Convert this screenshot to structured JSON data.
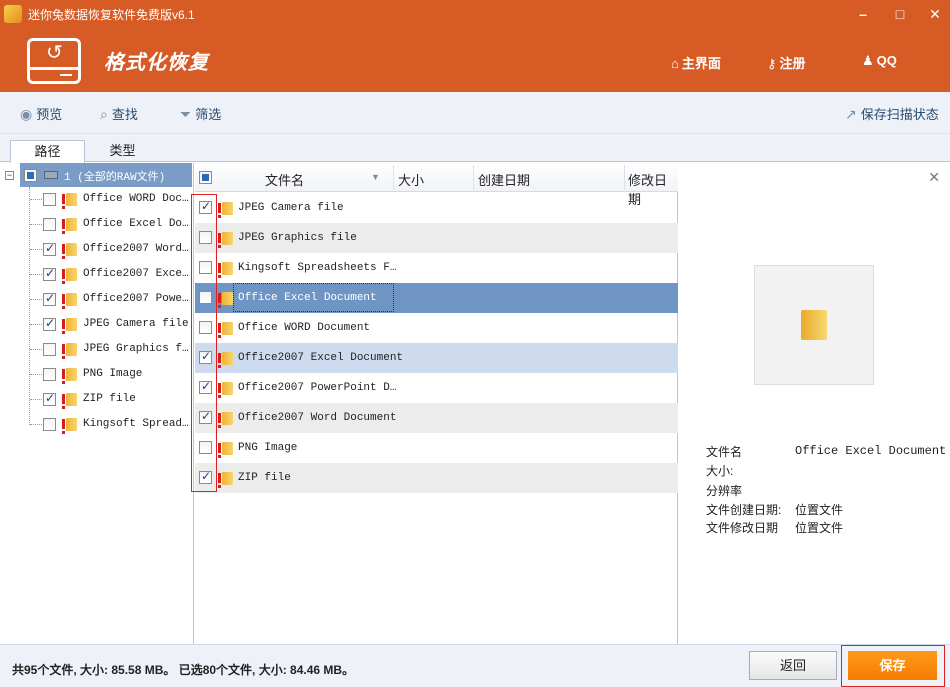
{
  "window": {
    "title": "迷你兔数据恢复软件免费版v6.1"
  },
  "header": {
    "page_title": "格式化恢复",
    "home_label": "主界面",
    "register_label": "注册",
    "qq_label": "QQ"
  },
  "toolbar": {
    "preview_label": "预览",
    "find_label": "查找",
    "filter_label": "筛选",
    "save_scan_label": "保存扫描状态"
  },
  "tabs": [
    {
      "label": "路径"
    },
    {
      "label": "类型"
    }
  ],
  "tree": {
    "root_label": "1  (全部的RAW文件)",
    "items": [
      {
        "label": "Office WORD Doc…",
        "checked": false
      },
      {
        "label": "Office Excel Do…",
        "checked": false
      },
      {
        "label": "Office2007 Word…",
        "checked": true
      },
      {
        "label": "Office2007 Exce…",
        "checked": true
      },
      {
        "label": "Office2007 Powe…",
        "checked": true
      },
      {
        "label": "JPEG Camera file",
        "checked": true
      },
      {
        "label": "JPEG Graphics f…",
        "checked": false
      },
      {
        "label": "PNG Image",
        "checked": false
      },
      {
        "label": "ZIP file",
        "checked": true
      },
      {
        "label": "Kingsoft Spread…",
        "checked": false
      }
    ]
  },
  "list": {
    "columns": [
      "文件名",
      "大小",
      "创建日期",
      "修改日期"
    ],
    "rows": [
      {
        "name": "JPEG Camera file",
        "checked": true
      },
      {
        "name": "JPEG Graphics file",
        "checked": false
      },
      {
        "name": "Kingsoft Spreadsheets F…",
        "checked": false
      },
      {
        "name": "Office Excel Document",
        "checked": false
      },
      {
        "name": "Office WORD Document",
        "checked": false
      },
      {
        "name": "Office2007 Excel Document",
        "checked": true
      },
      {
        "name": "Office2007 PowerPoint D…",
        "checked": true
      },
      {
        "name": "Office2007 Word Document",
        "checked": true
      },
      {
        "name": "PNG Image",
        "checked": false
      },
      {
        "name": "ZIP file",
        "checked": true
      }
    ]
  },
  "preview": {
    "labels": {
      "filename": "文件名",
      "size": "大小:",
      "resolution": "分辨率",
      "created": "文件创建日期:",
      "modified": "文件修改日期"
    },
    "values": {
      "filename": "Office Excel Document",
      "size": "",
      "resolution": "",
      "created": "位置文件",
      "modified": "位置文件"
    }
  },
  "status": {
    "summary": "共95个文件, 大小: 85.58 MB。 已选80个文件, 大小: 84.46 MB。",
    "back_label": "返回",
    "save_label": "保存"
  },
  "colors": {
    "brand": "#d75b25",
    "accent": "#f57d00",
    "selection": "#6f95c4"
  }
}
